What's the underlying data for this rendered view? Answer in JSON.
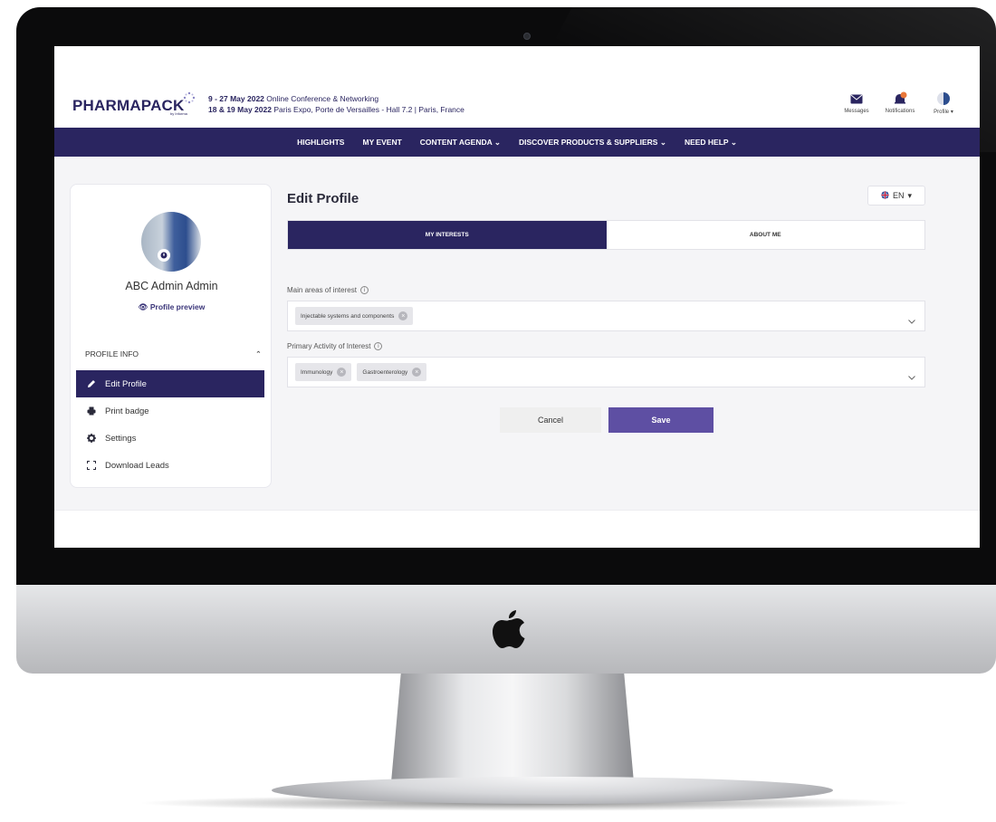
{
  "brand": {
    "logo_text": "PHARMAPACK",
    "logo_sub": "by Informa",
    "primary_color": "#2a2560",
    "accent_color": "#5e4fa3",
    "notification_color": "#e8773a"
  },
  "event": {
    "line1_date": "9 - 27 May 2022",
    "line1_text": "Online Conference & Networking",
    "line2_date": "18 & 19 May 2022",
    "line2_text": "Paris Expo, Porte de Versailles - Hall 7.2 | Paris, France"
  },
  "top_icons": {
    "messages_label": "Messages",
    "notifications_label": "Notifications",
    "profile_label": "Profile"
  },
  "nav": {
    "items": [
      "HIGHLIGHTS",
      "MY EVENT",
      "CONTENT AGENDA",
      "DISCOVER PRODUCTS & SUPPLIERS",
      "NEED HELP"
    ]
  },
  "sidebar": {
    "user_name": "ABC Admin Admin",
    "profile_preview": "Profile preview",
    "section_title": "PROFILE INFO",
    "menu": [
      {
        "label": "Edit Profile",
        "icon": "pencil-icon",
        "active": true
      },
      {
        "label": "Print badge",
        "icon": "printer-icon",
        "active": false
      },
      {
        "label": "Settings",
        "icon": "gear-icon",
        "active": false
      },
      {
        "label": "Download Leads",
        "icon": "scan-icon",
        "active": false
      }
    ]
  },
  "main": {
    "title": "Edit Profile",
    "language": "EN",
    "tabs": [
      {
        "label": "MY INTERESTS",
        "active": true
      },
      {
        "label": "ABOUT ME",
        "active": false
      }
    ],
    "fields": [
      {
        "label": "Main areas of interest",
        "chips": [
          "Injectable systems and components"
        ]
      },
      {
        "label": "Primary Activity of Interest",
        "chips": [
          "Immunology",
          "Gastroenterology"
        ]
      }
    ],
    "cancel_label": "Cancel",
    "save_label": "Save"
  }
}
